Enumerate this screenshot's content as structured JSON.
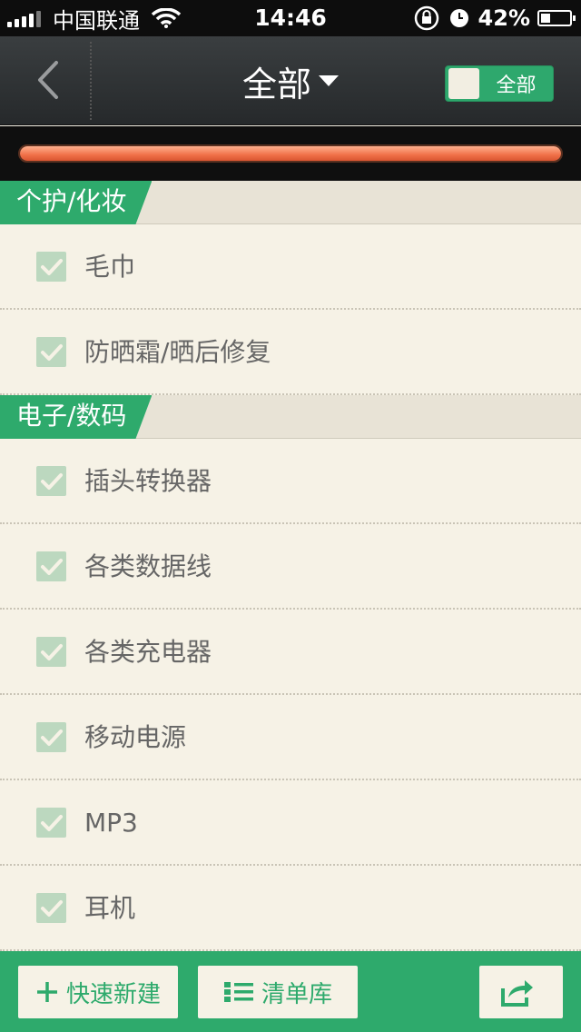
{
  "status_bar": {
    "carrier": "中国联通",
    "time": "14:46",
    "battery_percent": "42%",
    "battery_level": 0.42,
    "icons": [
      "signal-icon",
      "wifi-icon",
      "rotation-lock-icon",
      "alarm-icon",
      "battery-icon"
    ]
  },
  "nav": {
    "back_icon": "chevron-left-icon",
    "title": "全部",
    "title_icon": "caret-down-icon",
    "toggle_label": "全部"
  },
  "progress": {
    "value": 1.0
  },
  "sections": [
    {
      "title": "个护/化妆",
      "items": [
        {
          "label": "毛巾",
          "checked": true
        },
        {
          "label": "防晒霜/晒后修复",
          "checked": true
        }
      ]
    },
    {
      "title": "电子/数码",
      "items": [
        {
          "label": "插头转换器",
          "checked": true
        },
        {
          "label": "各类数据线",
          "checked": true
        },
        {
          "label": "各类充电器",
          "checked": true
        },
        {
          "label": "移动电源",
          "checked": true
        },
        {
          "label": "MP3",
          "checked": true
        },
        {
          "label": "耳机",
          "checked": true
        }
      ]
    }
  ],
  "bottom_bar": {
    "quick_new_label": "快速新建",
    "library_label": "清单库",
    "share_icon": "share-icon"
  },
  "colors": {
    "accent_green": "#2eaa6c",
    "background": "#f6f2e6",
    "progress_orange": "#f07048",
    "nav_dark": "#2e3234"
  }
}
